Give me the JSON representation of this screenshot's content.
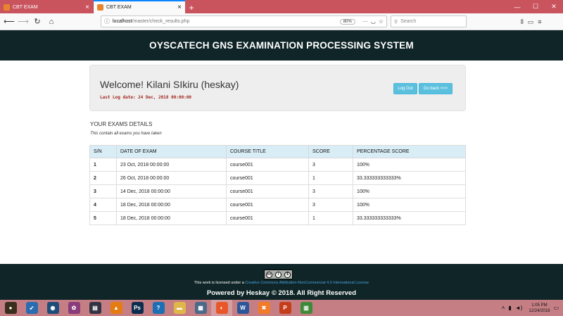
{
  "browser": {
    "tabs": [
      {
        "title": "CBT EXAM",
        "active": false
      },
      {
        "title": "CBT EXAM",
        "active": true
      }
    ],
    "url_host": "localhost",
    "url_path": "/master/check_results.php",
    "zoom": "80%",
    "search_placeholder": "Search"
  },
  "header": {
    "title": "OYSCATECH GNS EXAMINATION PROCESSING SYSTEM"
  },
  "welcome": {
    "greeting": "Welcome! Kilani SIkiru (heskay)",
    "last_log": "Last Log date: 24 Dec, 2018 00:00:00",
    "logout_label": "Log Out",
    "back_label": "Go back <<<"
  },
  "exams": {
    "title": "YOUR EXAMS DETAILS",
    "subtitle": "This contain all exams you have taken",
    "columns": [
      "S/N",
      "DATE OF EXAM",
      "COURSE TITLE",
      "SCORE",
      "PERCENTAGE SCORE"
    ],
    "rows": [
      [
        "1",
        "23 Oct, 2018 00:00:00",
        "course001",
        "3",
        "100%"
      ],
      [
        "2",
        "26 Oct, 2018 00:00:00",
        "course001",
        "1",
        "33.333333333333%"
      ],
      [
        "3",
        "14 Dec, 2018 00:00:00",
        "course001",
        "3",
        "100%"
      ],
      [
        "4",
        "18 Dec, 2018 00:00:00",
        "course001",
        "3",
        "100%"
      ],
      [
        "5",
        "18 Dec, 2018 00:00:00",
        "course001",
        "1",
        "33.333333333333%"
      ]
    ]
  },
  "footer": {
    "license_prefix": "This work is licensed under a",
    "license_link": "Creative Commons Attribution-NonCommercial 4.0 International License",
    "powered": "Powered by Heskay © 2018. All Right Reserved"
  },
  "taskbar": {
    "time": "1:05 PM",
    "date": "12/24/2018",
    "apps": [
      {
        "name": "media-player-icon",
        "color": "#3a2f1c",
        "glyph": "●"
      },
      {
        "name": "rocket-icon",
        "color": "#2b6cb0",
        "glyph": "➶"
      },
      {
        "name": "badge-icon",
        "color": "#1f4d7a",
        "glyph": "◉"
      },
      {
        "name": "paint-icon",
        "color": "#8a3b7a",
        "glyph": "✿"
      },
      {
        "name": "film-icon",
        "color": "#334",
        "glyph": "▤"
      },
      {
        "name": "vlc-icon",
        "color": "#e57c12",
        "glyph": "▲"
      },
      {
        "name": "photoshop-icon",
        "color": "#0c2d4e",
        "glyph": "Ps"
      },
      {
        "name": "help-icon",
        "color": "#1c6fb5",
        "glyph": "?"
      },
      {
        "name": "folder-icon",
        "color": "#e0b64a",
        "glyph": "▬"
      },
      {
        "name": "network-icon",
        "color": "#4b6a8a",
        "glyph": "▦"
      },
      {
        "name": "firefox-icon",
        "color": "#e8572a",
        "glyph": "◐"
      },
      {
        "name": "word-icon",
        "color": "#2b579a",
        "glyph": "W"
      },
      {
        "name": "xampp-icon",
        "color": "#f27b2a",
        "glyph": "✖"
      },
      {
        "name": "powerpoint-icon",
        "color": "#c43e1c",
        "glyph": "P"
      },
      {
        "name": "chart-app-icon",
        "color": "#3f8a3a",
        "glyph": "▥"
      }
    ]
  }
}
